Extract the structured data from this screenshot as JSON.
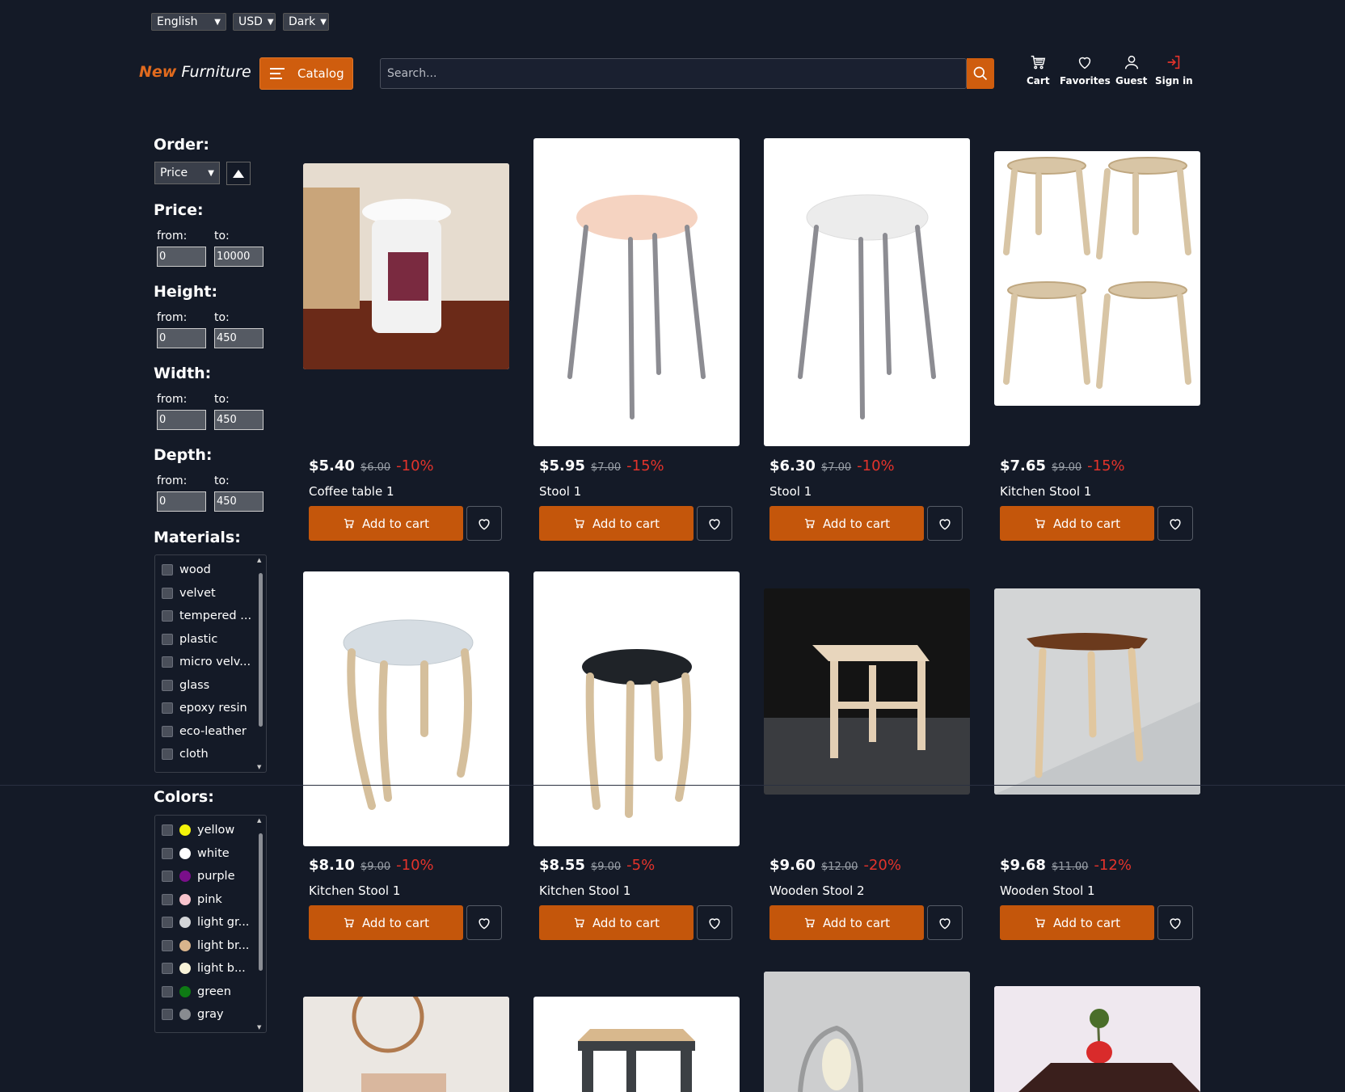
{
  "top_controls": {
    "language": "English",
    "currency": "USD",
    "theme": "Dark"
  },
  "header": {
    "logo_new": "New",
    "logo_furniture": "Furniture",
    "catalog_label": "Catalog",
    "search_placeholder": "Search...",
    "nav": [
      {
        "label": "Cart",
        "icon": "cart-icon"
      },
      {
        "label": "Favorites",
        "icon": "heart-icon"
      },
      {
        "label": "Guest",
        "icon": "user-icon"
      },
      {
        "label": "Sign in",
        "icon": "sign-in-icon"
      }
    ]
  },
  "filters": {
    "order_label": "Order:",
    "order_value": "Price",
    "price": {
      "label": "Price:",
      "from_label": "from:",
      "to_label": "to:",
      "from": "0",
      "to": "10000"
    },
    "height": {
      "label": "Height:",
      "from_label": "from:",
      "to_label": "to:",
      "from": "0",
      "to": "450"
    },
    "width": {
      "label": "Width:",
      "from_label": "from:",
      "to_label": "to:",
      "from": "0",
      "to": "450"
    },
    "depth": {
      "label": "Depth:",
      "from_label": "from:",
      "to_label": "to:",
      "from": "0",
      "to": "450"
    },
    "materials_label": "Materials:",
    "materials": [
      "wood",
      "velvet",
      "tempered ...",
      "plastic",
      "micro velv...",
      "glass",
      "epoxy resin",
      "eco-leather",
      "cloth"
    ],
    "colors_label": "Colors:",
    "colors": [
      {
        "name": "yellow",
        "hex": "#f4f40a"
      },
      {
        "name": "white",
        "hex": "#ffffff"
      },
      {
        "name": "purple",
        "hex": "#7a0f8a"
      },
      {
        "name": "pink",
        "hex": "#f7c3cd"
      },
      {
        "name": "light gr...",
        "hex": "#d3d5d8"
      },
      {
        "name": "light br...",
        "hex": "#d9b48c"
      },
      {
        "name": "light b...",
        "hex": "#f8f2d8"
      },
      {
        "name": "green",
        "hex": "#0e7a14"
      },
      {
        "name": "gray",
        "hex": "#888b90"
      }
    ]
  },
  "add_to_cart_label": "Add to cart",
  "products": [
    {
      "price": "$5.40",
      "old": "$6.00",
      "disc": "-10%",
      "name": "Coffee table 1"
    },
    {
      "price": "$5.95",
      "old": "$7.00",
      "disc": "-15%",
      "name": "Stool 1"
    },
    {
      "price": "$6.30",
      "old": "$7.00",
      "disc": "-10%",
      "name": "Stool 1"
    },
    {
      "price": "$7.65",
      "old": "$9.00",
      "disc": "-15%",
      "name": "Kitchen Stool 1"
    },
    {
      "price": "$8.10",
      "old": "$9.00",
      "disc": "-10%",
      "name": "Kitchen Stool 1"
    },
    {
      "price": "$8.55",
      "old": "$9.00",
      "disc": "-5%",
      "name": "Kitchen Stool 1"
    },
    {
      "price": "$9.60",
      "old": "$12.00",
      "disc": "-20%",
      "name": "Wooden Stool 2"
    },
    {
      "price": "$9.68",
      "old": "$11.00",
      "disc": "-12%",
      "name": "Wooden Stool 1"
    }
  ],
  "accent": "#c4560b"
}
